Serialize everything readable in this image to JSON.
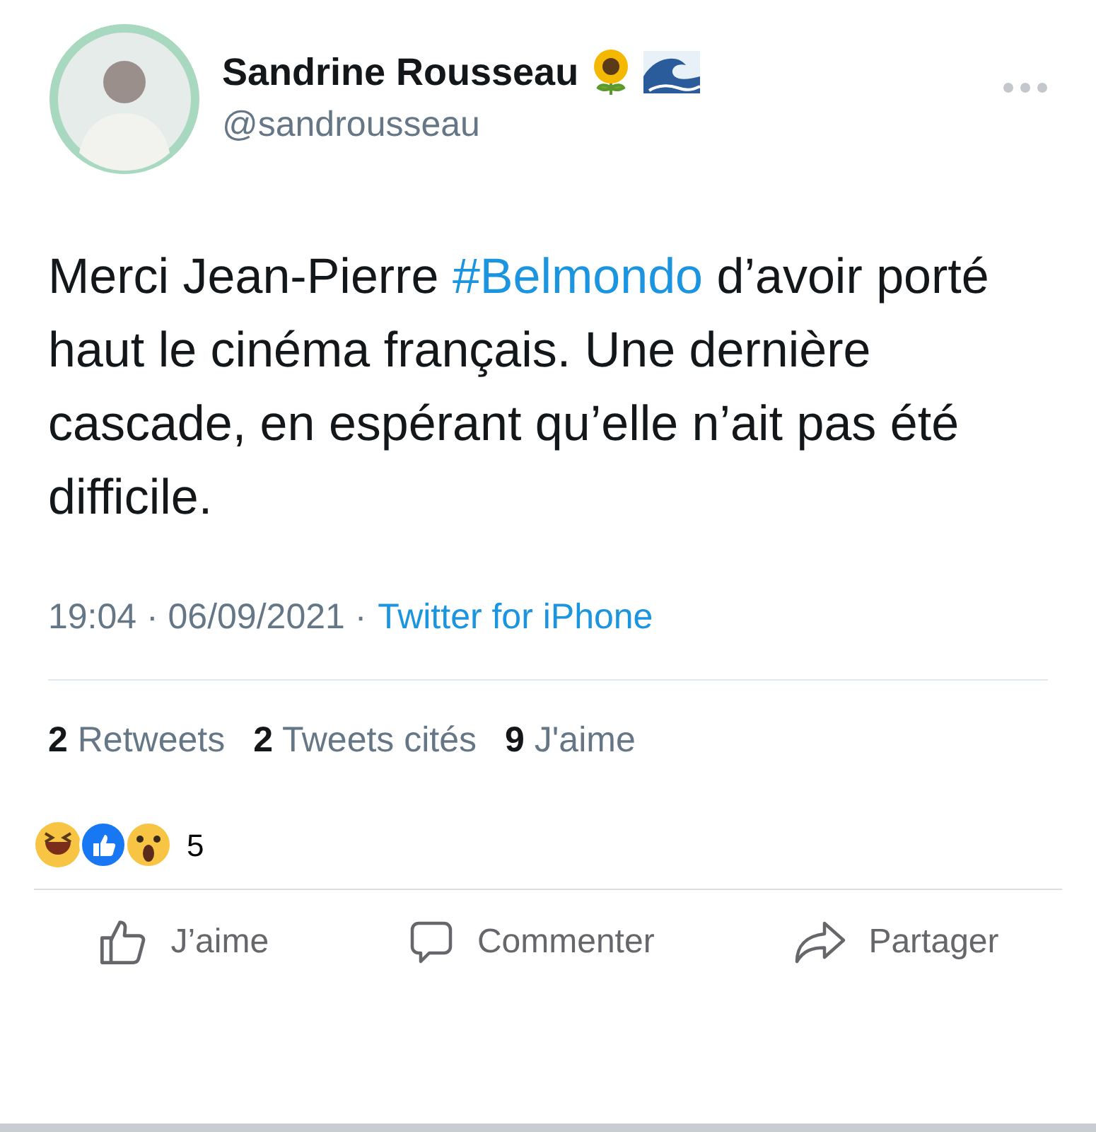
{
  "author": {
    "name": "Sandrine Rousseau",
    "handle": "@sandrousseau"
  },
  "tweet": {
    "text_before": "Merci Jean-Pierre",
    "hashtag": "#Belmondo",
    "text_after": "d’avoir porté haut le cinéma français. Une dernière cascade, en espérant qu’elle n’ait pas été difficile."
  },
  "meta": {
    "time": "19:04 · 06/09/2021 ·",
    "source": "Twitter for iPhone"
  },
  "stats": [
    {
      "count": "2",
      "label": "Retweets"
    },
    {
      "count": "2",
      "label": "Tweets cités"
    },
    {
      "count": "9",
      "label": "J'aime"
    }
  ],
  "reactions": {
    "count": "5"
  },
  "actions": [
    {
      "kind": "like",
      "label": "J’aime"
    },
    {
      "kind": "comment",
      "label": "Commenter"
    },
    {
      "kind": "share",
      "label": "Partager"
    }
  ]
}
